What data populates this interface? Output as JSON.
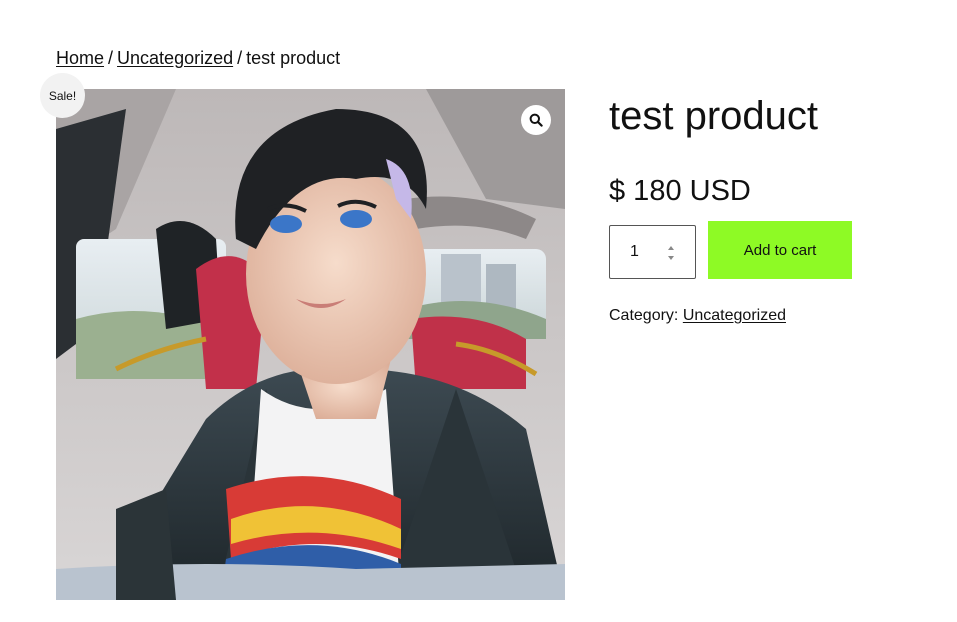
{
  "breadcrumb": {
    "home": "Home",
    "separator": "/",
    "category": "Uncategorized",
    "current": "test product"
  },
  "gallery": {
    "sale_badge": "Sale!",
    "zoom_icon": "magnifier-icon",
    "image_subject": "anime-style selfie of a young man with dark hair inside a car"
  },
  "product": {
    "title": "test product",
    "price": "$ 180 USD",
    "quantity": "1",
    "add_to_cart_label": "Add to cart",
    "category_label": "Category:",
    "category_value": "Uncategorized"
  },
  "colors": {
    "add_to_cart_bg": "#8efa25",
    "badge_bg": "#f2f2f2",
    "text": "#111111"
  }
}
